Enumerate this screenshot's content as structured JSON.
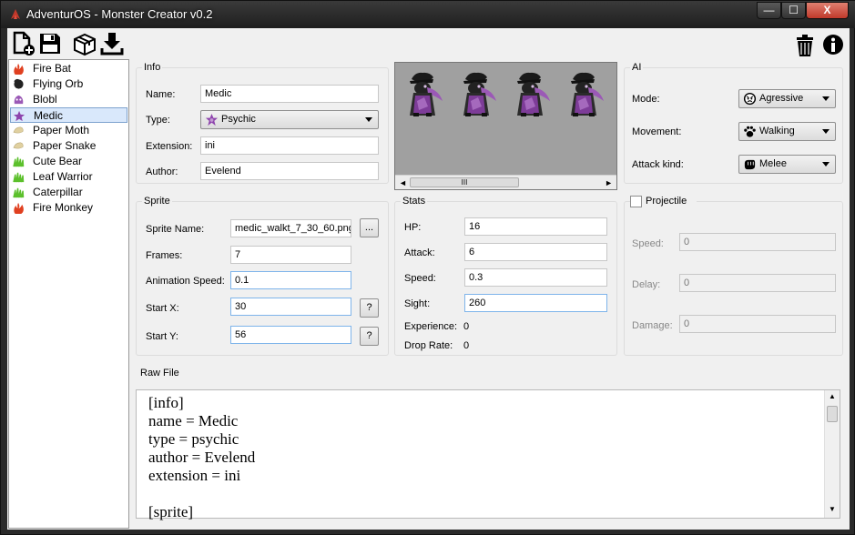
{
  "window": {
    "title": "AdventurOS - Monster Creator v0.2",
    "buttons": {
      "minimize": "—",
      "maximize": "☐",
      "close": "X"
    }
  },
  "toolbar": {
    "icons": [
      "new-file-icon",
      "save-icon",
      "package-icon",
      "download-icon",
      "trash-icon",
      "info-icon"
    ]
  },
  "monsters": [
    {
      "name": "Fire Bat",
      "icon": "fire-icon",
      "color": "#e04020"
    },
    {
      "name": "Flying Orb",
      "icon": "orb-icon",
      "color": "#222222"
    },
    {
      "name": "Blobl",
      "icon": "blob-icon",
      "color": "#9b59b6"
    },
    {
      "name": "Medic",
      "icon": "psychic-icon",
      "color": "#8e44ad",
      "selected": true
    },
    {
      "name": "Paper Moth",
      "icon": "paper-icon",
      "color": "#e0d0a0"
    },
    {
      "name": "Paper Snake",
      "icon": "paper-icon",
      "color": "#e0d0a0"
    },
    {
      "name": "Cute Bear",
      "icon": "grass-icon",
      "color": "#5cc02c"
    },
    {
      "name": "Leaf Warrior",
      "icon": "grass-icon",
      "color": "#5cc02c"
    },
    {
      "name": "Caterpillar",
      "icon": "grass-icon",
      "color": "#5cc02c"
    },
    {
      "name": "Fire Monkey",
      "icon": "fire-icon",
      "color": "#e04020"
    }
  ],
  "info": {
    "title": "Info",
    "name_label": "Name:",
    "name_value": "Medic",
    "type_label": "Type:",
    "type_value": "Psychic",
    "extension_label": "Extension:",
    "extension_value": "ini",
    "author_label": "Author:",
    "author_value": "Evelend"
  },
  "preview": {
    "scroll_grip": "III"
  },
  "ai": {
    "title": "AI",
    "mode_label": "Mode:",
    "mode_value": "Agressive",
    "movement_label": "Movement:",
    "movement_value": "Walking",
    "attack_label": "Attack kind:",
    "attack_value": "Melee"
  },
  "sprite": {
    "title": "Sprite",
    "sprite_name_label": "Sprite Name:",
    "sprite_name_value": "medic_walkt_7_30_60.png",
    "browse_label": "...",
    "frames_label": "Frames:",
    "frames_value": "7",
    "anim_speed_label": "Animation Speed:",
    "anim_speed_value": "0.1",
    "start_x_label": "Start X:",
    "start_x_value": "30",
    "start_y_label": "Start Y:",
    "start_y_value": "56",
    "help_label": "?"
  },
  "stats": {
    "title": "Stats",
    "hp_label": "HP:",
    "hp_value": "16",
    "attack_label": "Attack:",
    "attack_value": "6",
    "speed_label": "Speed:",
    "speed_value": "0.3",
    "sight_label": "Sight:",
    "sight_value": "260",
    "experience_label": "Experience:",
    "experience_value": "0",
    "drop_rate_label": "Drop Rate:",
    "drop_rate_value": "0"
  },
  "projectile": {
    "title": "Projectile",
    "speed_label": "Speed:",
    "speed_value": "0",
    "delay_label": "Delay:",
    "delay_value": "0",
    "damage_label": "Damage:",
    "damage_value": "0"
  },
  "raw": {
    "title": "Raw File",
    "text": "[info]\nname = Medic\ntype = psychic\nauthor = Evelend\nextension = ini\n\n[sprite]"
  },
  "colors": {
    "selection": "#d9e8fb",
    "preview_bg": "#a0a0a0",
    "psychic": "#8e44ad"
  }
}
